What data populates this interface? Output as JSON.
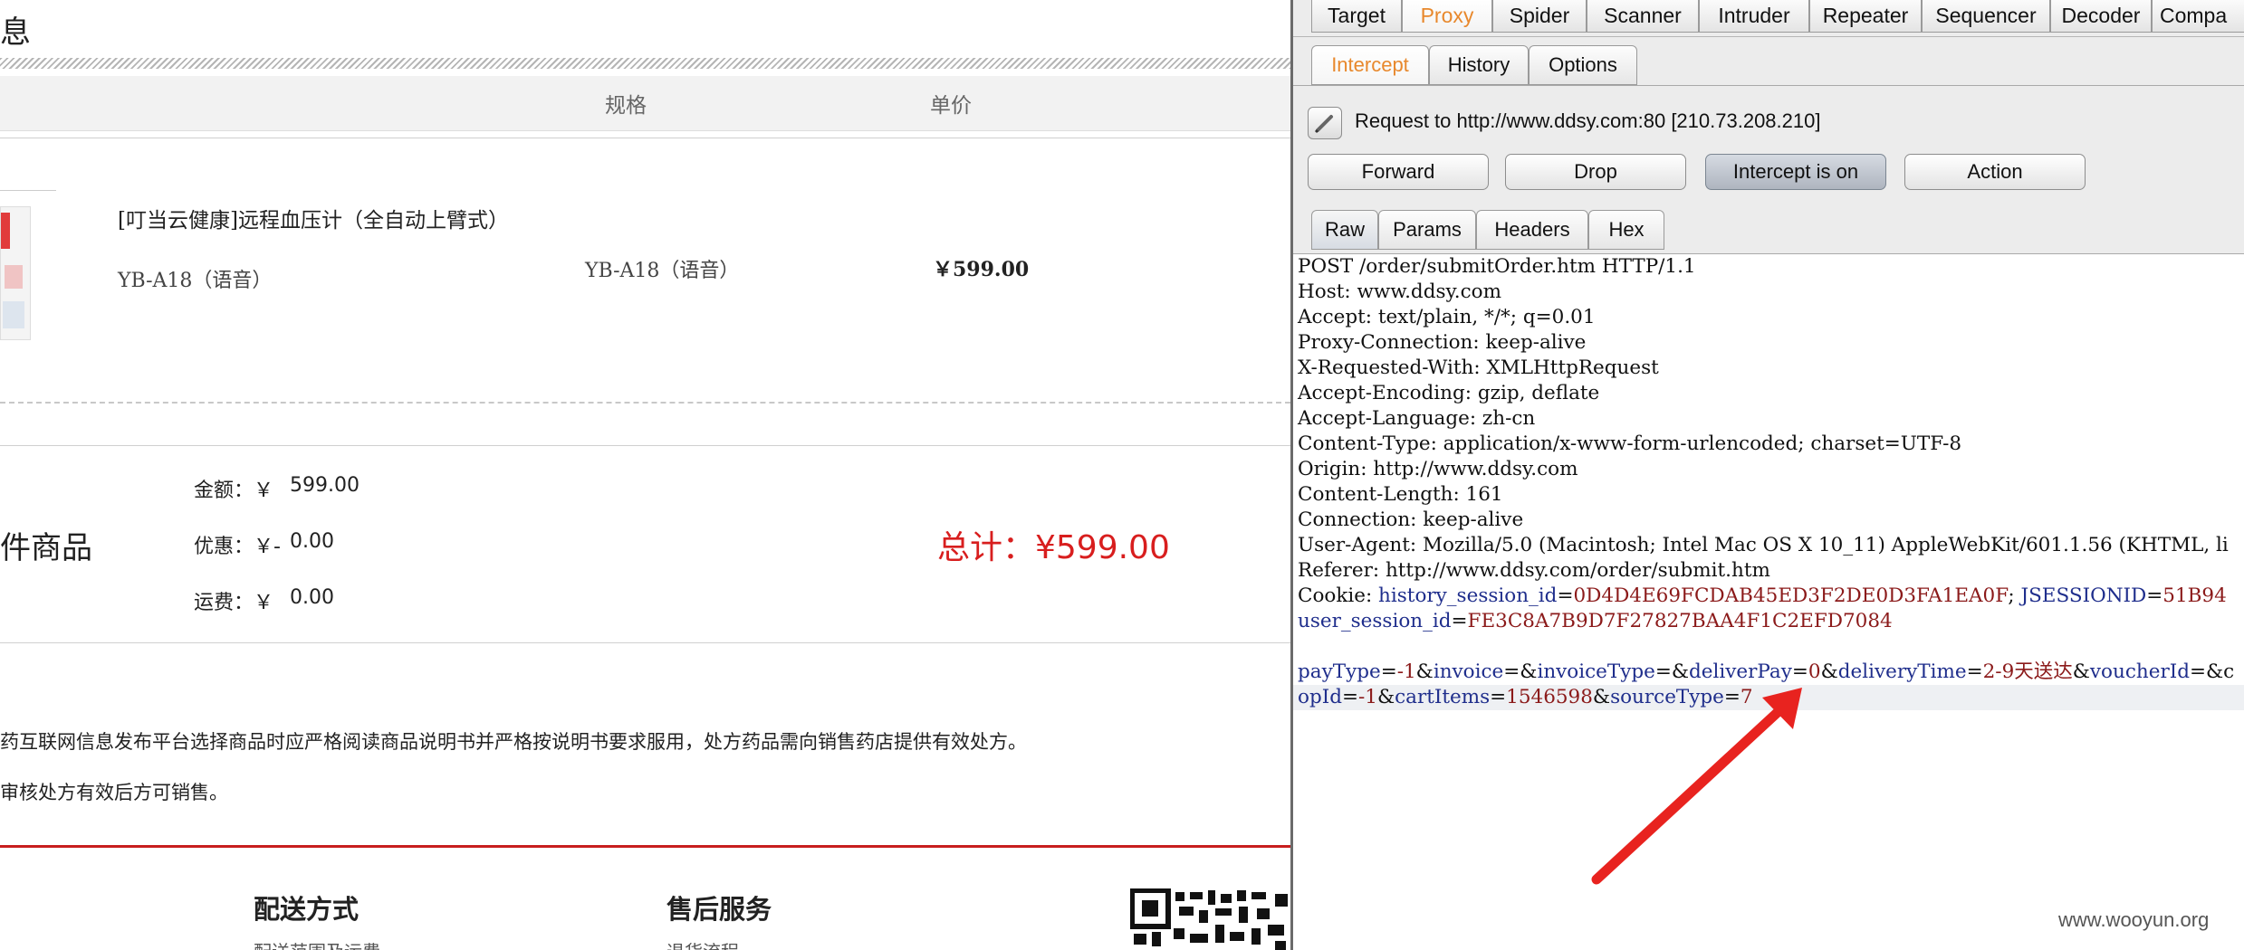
{
  "left_page": {
    "section_title_fragment": "息",
    "table_headers": {
      "spec": "规格",
      "price": "单价"
    },
    "product": {
      "name": "[叮当云健康]远程血压计（全自动上臂式）",
      "variant": "YB-A18（语音）",
      "spec": "YB-A18（语音）",
      "price": "￥599.00"
    },
    "summary": {
      "label_fragment": "件商品",
      "amount_label": "金额：￥",
      "amount_value": "599.00",
      "discount_label": "优惠：￥-",
      "discount_value": "0.00",
      "shipping_label": "运费：￥",
      "shipping_value": "0.00",
      "total": "总计：¥599.00"
    },
    "notices": [
      "药互联网信息发布平台选择商品时应严格阅读商品说明书并严格按说明书要求服用，处方药品需向销售药店提供有效处方。",
      "审核处方有效后方可销售。"
    ],
    "footer": {
      "col1_title": "配送方式",
      "col1_item": "配送范围及运费",
      "col2_title": "售后服务",
      "col2_item": "退货流程"
    }
  },
  "burp": {
    "main_tabs": [
      "Target",
      "Proxy",
      "Spider",
      "Scanner",
      "Intruder",
      "Repeater",
      "Sequencer",
      "Decoder",
      "Compa"
    ],
    "active_main_tab": "Proxy",
    "proxy_tabs": [
      "Intercept",
      "History",
      "Options"
    ],
    "active_proxy_tab": "Intercept",
    "request_to": "Request to http://www.ddsy.com:80  [210.73.208.210]",
    "buttons": {
      "forward": "Forward",
      "drop": "Drop",
      "intercept": "Intercept is on",
      "action": "Action"
    },
    "view_tabs": [
      "Raw",
      "Params",
      "Headers",
      "Hex"
    ],
    "active_view_tab": "Raw",
    "headers": [
      "POST /order/submitOrder.htm HTTP/1.1",
      "Host: www.ddsy.com",
      "Accept: text/plain, */*; q=0.01",
      "Proxy-Connection: keep-alive",
      "X-Requested-With: XMLHttpRequest",
      "Accept-Encoding: gzip, deflate",
      "Accept-Language: zh-cn",
      "Content-Type: application/x-www-form-urlencoded; charset=UTF-8",
      "Origin: http://www.ddsy.com",
      "Content-Length: 161",
      "Connection: keep-alive",
      "User-Agent: Mozilla/5.0 (Macintosh; Intel Mac OS X 10_11) AppleWebKit/601.1.56 (KHTML, li",
      "Referer: http://www.ddsy.com/order/submit.htm"
    ],
    "cookie": {
      "label": "Cookie: ",
      "history_key": "history_session_id",
      "history_val": "0D4D4E69FCDAB45ED3F2DE0D3FA1EA0F",
      "jsession_key": "JSESSIONID",
      "jsession_val": "51B94",
      "user_key": "user_session_id",
      "user_val": "FE3C8A7B9D7F27827BAA4F1C2EFD7084"
    },
    "body": {
      "payType_key": "payType",
      "payType_val": "-1",
      "invoice_key": "invoice",
      "invoiceType_key": "invoiceType",
      "deliverPay_key": "deliverPay",
      "deliverPay_val": "0",
      "deliveryTime_key": "deliveryTime",
      "deliveryTime_val": "2-9天送达",
      "voucherId_key": "voucherId",
      "tail": "&c",
      "shopId_key": "opId",
      "shopId_val": "-1",
      "cartItems_key": "cartItems",
      "cartItems_val": "1546598",
      "sourceType_key": "sourceType",
      "sourceType_val": "7"
    },
    "watermark": "www.wooyun.org"
  },
  "colors": {
    "total_red": "#d81e1e",
    "burp_orange": "#e8882c",
    "arrow_red": "#e8231f",
    "param_blue": "#1f2e8c",
    "value_red": "#8b1a1a"
  }
}
